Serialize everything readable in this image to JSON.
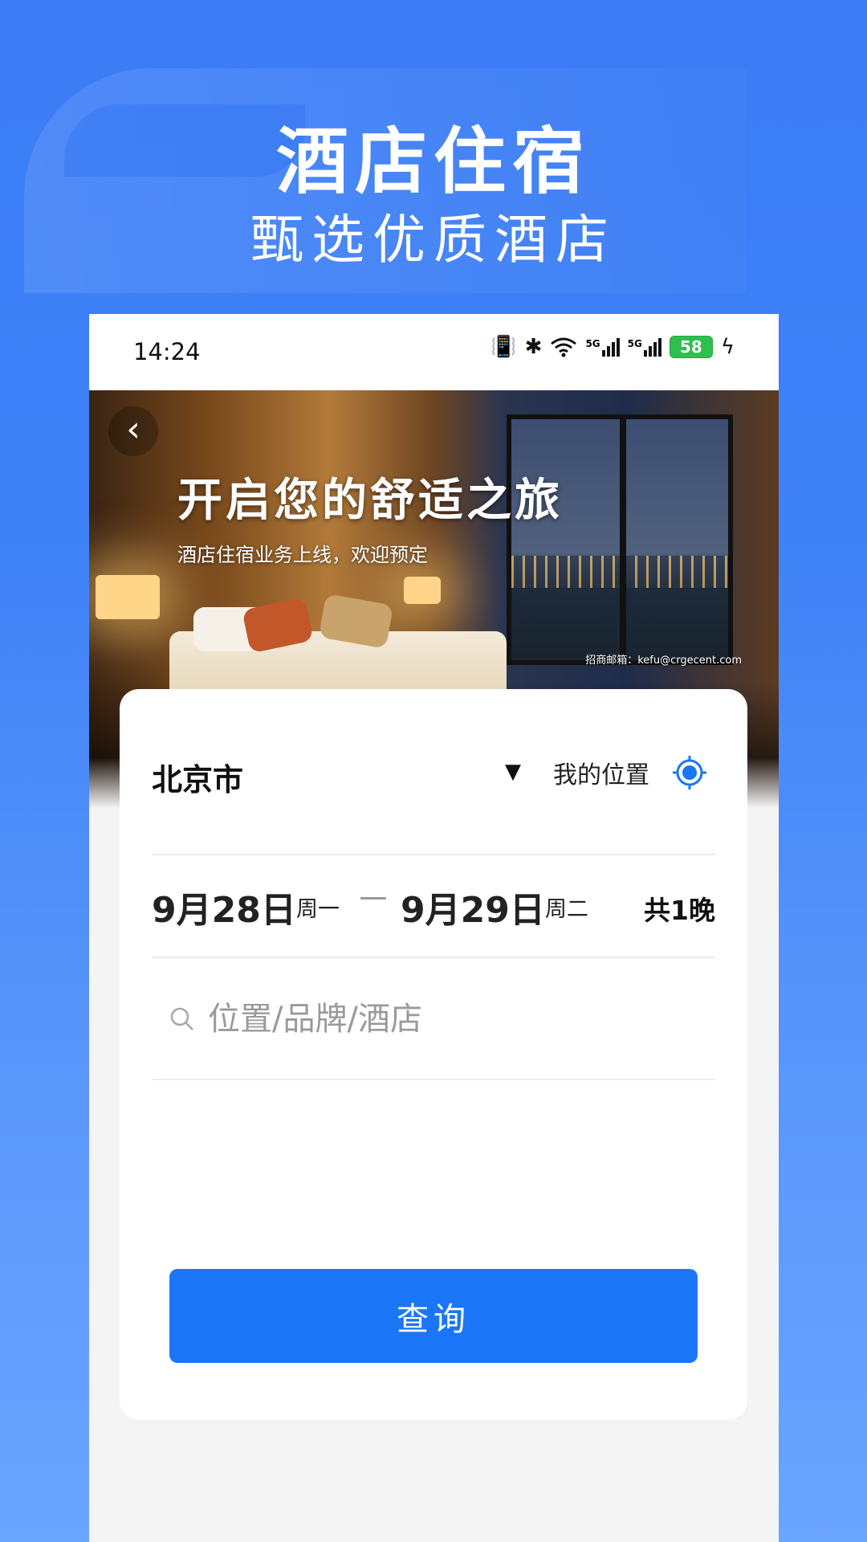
{
  "hero": {
    "title": "酒店住宿",
    "subtitle": "甄选优质酒店"
  },
  "status_bar": {
    "time": "14:24",
    "network_1": "5G",
    "network_2": "5G",
    "battery": "58"
  },
  "banner": {
    "title": "开启您的舒适之旅",
    "subtitle": "酒店住宿业务上线，欢迎预定",
    "contact": "招商邮箱：kefu@crgecent.com"
  },
  "form": {
    "city": "北京市",
    "my_location_label": "我的位置",
    "checkin_date": "9月28日",
    "checkin_weekday": "周一",
    "checkout_date": "9月29日",
    "checkout_weekday": "周二",
    "nights": "共1晚",
    "search_placeholder": "位置/品牌/酒店",
    "search_value": "",
    "query_button": "查询"
  },
  "colors": {
    "background": "#3f82f7",
    "primary_button": "#1a76f6",
    "location_icon": "#1a76f6",
    "battery": "#2fbf4f"
  }
}
